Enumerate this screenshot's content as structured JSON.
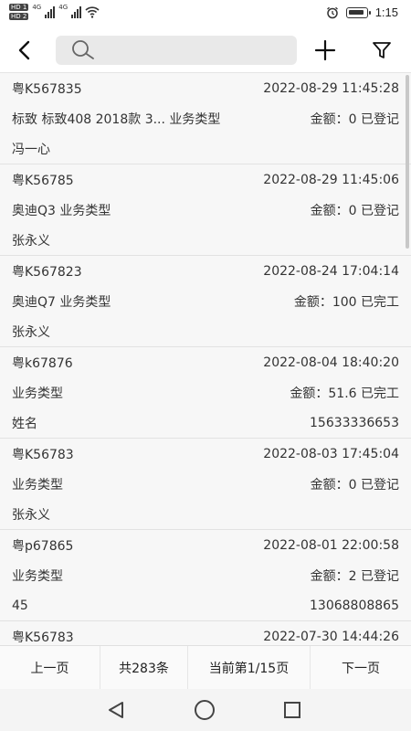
{
  "status_bar": {
    "sim1": "HD 1",
    "sim2": "HD 2",
    "network1": "4G",
    "network2": "4G",
    "time": "1:15"
  },
  "header": {
    "search_placeholder": "",
    "icons": [
      "back-arrow",
      "search",
      "plus",
      "filter"
    ]
  },
  "records": [
    {
      "plate": "粤K567835",
      "datetime": "2022-08-29 11:45:28",
      "desc": "标致 标致408 2018款 3... 业务类型",
      "amount_status": "金额：0 已登记",
      "name": "冯一心",
      "phone": ""
    },
    {
      "plate": "粤K56785",
      "datetime": "2022-08-29 11:45:06",
      "desc": "奥迪Q3 业务类型",
      "amount_status": "金额：0 已登记",
      "name": "张永义",
      "phone": ""
    },
    {
      "plate": "粤K567823",
      "datetime": "2022-08-24 17:04:14",
      "desc": "奥迪Q7 业务类型",
      "amount_status": "金额：100 已完工",
      "name": "张永义",
      "phone": ""
    },
    {
      "plate": "粤k67876",
      "datetime": "2022-08-04 18:40:20",
      "desc": "业务类型",
      "amount_status": "金额：51.6 已完工",
      "name": "姓名",
      "phone": "15633336653"
    },
    {
      "plate": "粤K56783",
      "datetime": "2022-08-03 17:45:04",
      "desc": "业务类型",
      "amount_status": "金额：0 已登记",
      "name": "张永义",
      "phone": ""
    },
    {
      "plate": "粤p67865",
      "datetime": "2022-08-01 22:00:58",
      "desc": "业务类型",
      "amount_status": "金额：2 已登记",
      "name": "45",
      "phone": "13068808865"
    },
    {
      "plate": "粤K56783",
      "datetime": "2022-07-30 14:44:26",
      "desc": "",
      "amount_status": "",
      "name": "",
      "phone": ""
    }
  ],
  "pager": {
    "prev": "上一页",
    "total": "共283条",
    "current": "当前第1/15页",
    "next": "下一页"
  },
  "colors": {
    "list_bg": "#f7f7f7",
    "search_bg": "#e9e9e9",
    "divider": "#e2e2e2"
  }
}
